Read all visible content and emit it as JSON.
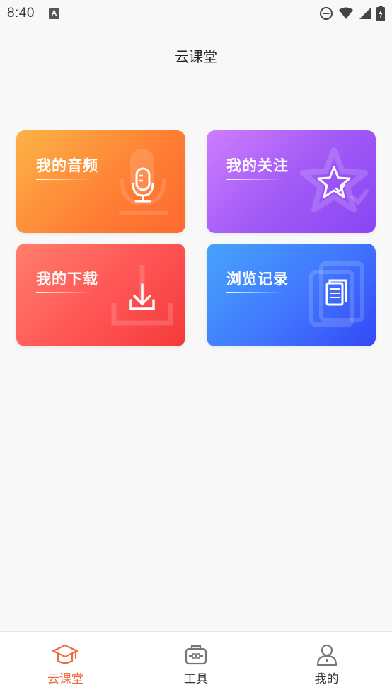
{
  "status_bar": {
    "time": "8:40",
    "notification_icon_letter": "A"
  },
  "header": {
    "title": "云课堂"
  },
  "cards": [
    {
      "id": "audio",
      "label": "我的音频",
      "icon": "microphone-icon"
    },
    {
      "id": "follow",
      "label": "我的关注",
      "icon": "star-icon"
    },
    {
      "id": "download",
      "label": "我的下载",
      "icon": "download-icon"
    },
    {
      "id": "history",
      "label": "浏览记录",
      "icon": "document-icon"
    }
  ],
  "tabs": [
    {
      "label": "云课堂",
      "icon": "graduation-cap-icon",
      "active": true
    },
    {
      "label": "工具",
      "icon": "toolbox-icon",
      "active": false
    },
    {
      "label": "我的",
      "icon": "user-icon",
      "active": false
    }
  ],
  "colors": {
    "accent": "#f06a3f",
    "audio_card": "#ff7e34",
    "follow_card": "#a25bf6",
    "download_card": "#ff5454",
    "history_card": "#4176ff"
  }
}
